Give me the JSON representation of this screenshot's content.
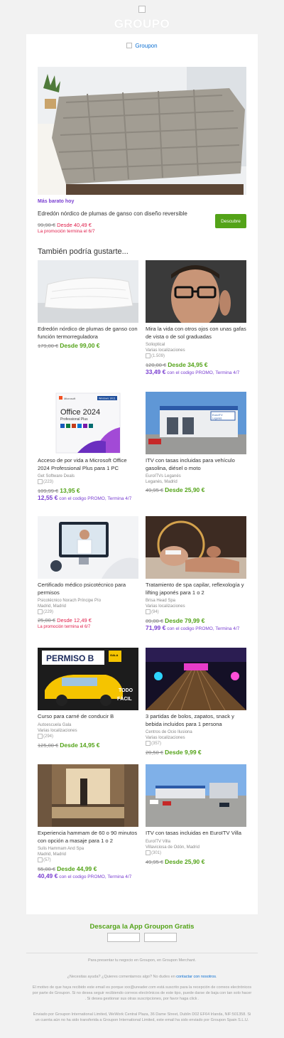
{
  "header": {
    "brand_text": "GROUPO"
  },
  "inner_logo": {
    "alt_text": "Groupon"
  },
  "hero": {
    "tag": "Más barato hoy",
    "title": "Edredón nórdico de plumas de ganso con diseño reversible",
    "old_price": "99,90 €",
    "new_price": "Desde 40,49 €",
    "expiry": "La promoción termina el 6/7",
    "cta": "Descubre"
  },
  "section": {
    "title": "También podría gustarte..."
  },
  "deals": [
    {
      "title": "Edredón nórdico de plumas de ganso con función termorreguladora",
      "merchant": "",
      "location": "",
      "rating": "",
      "old_price": "179,00 €",
      "new_price": "Desde 99,00 €",
      "promo_price": "",
      "promo_text": "",
      "expiry": ""
    },
    {
      "title": "Mira la vida con otros ojos con unas gafas de vista o de sol graduadas",
      "merchant": "Solioptical",
      "location": "Varias localizaciones",
      "rating": "(1.509)",
      "old_price": "120,00 €",
      "new_price": "Desde 34,95 €",
      "promo_price": "33,49 €",
      "promo_text": "con el codigo PROMO, Termina 4/7",
      "expiry": ""
    },
    {
      "title": "Acceso de por vida a Microsoft Office 2024 Professional Plus para 1 PC",
      "merchant": "Get Software Deals",
      "location": "",
      "rating": "(223)",
      "old_price": "109,99 €",
      "new_price": "13,95 €",
      "promo_price": "12,55 €",
      "promo_text": "con el codigo PROMO, Termina 4/7",
      "expiry": ""
    },
    {
      "title": "ITV con tasas incluidas para vehículo gasolina, diésel o moto",
      "merchant": "EuroITVs Leganés",
      "location": "Leganés, Madrid",
      "rating": "",
      "old_price": "49,95 €",
      "new_price": "Desde 25,90 €",
      "promo_price": "",
      "promo_text": "",
      "expiry": ""
    },
    {
      "title": "Certificado médico psicotécnico para permisos",
      "merchant": "Psicotécnico Norach Príncipe Pío",
      "location": "Madrid, Madrid",
      "rating": "(229)",
      "old_price": "25,00 €",
      "new_price": "Desde 12,49 €",
      "promo_price": "",
      "promo_text": "",
      "expiry": "La promoción termina el 6/7"
    },
    {
      "title": "Tratamiento de spa capilar, reflexología y lifting japonés para 1 o 2",
      "merchant": "Brisa Head Spa",
      "location": "Varias localizaciones",
      "rating": "(94)",
      "old_price": "89,00 €",
      "new_price": "Desde 79,99 €",
      "promo_price": "71,99 €",
      "promo_text": "con el codigo PROMO, Termina 4/7",
      "expiry": ""
    },
    {
      "title": "Curso para carné de conducir B",
      "merchant": "Autoescuela Gala",
      "location": "Varias localizaciones",
      "rating": "(294)",
      "old_price": "125,00 €",
      "new_price": "Desde 14,95 €",
      "promo_price": "",
      "promo_text": "",
      "expiry": ""
    },
    {
      "title": "3 partidas de bolos, zapatos, snack y bebida incluidos para 1 persona",
      "merchant": "Centros de Ocio Ilusiona",
      "location": "Varias localizaciones",
      "rating": "(357)",
      "old_price": "20,50 €",
      "new_price": "Desde 9,99 €",
      "promo_price": "",
      "promo_text": "",
      "expiry": ""
    },
    {
      "title": "Experiencia hammam de 60 o 90 minutos con opción a masaje para 1 o 2",
      "merchant": "Sulis Hammam And Spa",
      "location": "Madrid, Madrid",
      "rating": "(57)",
      "old_price": "55,00 €",
      "new_price": "Desde 44,99 €",
      "promo_price": "40,49 €",
      "promo_text": "con el codigo PROMO, Termina 4/7",
      "expiry": ""
    },
    {
      "title": "ITV con tasas incluidas en EuroITV Villa",
      "merchant": "EuroITV Villa",
      "location": "Villaviciosa de Odón, Madrid",
      "rating": "(301)",
      "old_price": "49,95 €",
      "new_price": "Desde 25,90 €",
      "promo_price": "",
      "promo_text": "",
      "expiry": ""
    }
  ],
  "thumb_text": {
    "office_brand": "Microsoft",
    "office_badge": "Windows 10/11",
    "office_title": "Office 2024",
    "office_subtitle": "Professional Plus",
    "itv_sign": "EuroITV",
    "itv_sign_sub": "Leganés",
    "permiso": "PERMISO B",
    "gala": "GALA",
    "todo": "TODO",
    "facil": "FÁCIL"
  },
  "footer": {
    "app_title": "Descarga la App Groupon Gratis",
    "merchant_note": "Para presentar tu negocio en Groupon, en Groupon Merchant.",
    "help_pre": "¿Necesitas ayuda? ¿Quieres comentarnos algo? No dudes en",
    "help_link": "contactar con nosotros",
    "help_post": ".",
    "reason": "El motivo de que haya recibido este email es porque xxx@ureader.com está suscrito para la recepción de correos electrónicos por parte de Groupon. Si no desea seguir recibiendo correos electrónicos de este tipo, puede darse de baja con tan solo hacer . Si desea gestionar sus otras suscripciones, por favor haga click .",
    "sender": "Enviado por Groupon International Limited, WeWork Central Plaza, 36 Dame Street, Dublin D02 EF64 Irlanda, NIF:501358. Si un cuenta aún no ha sido transferida a Groupon International Limited, este email ha sido enviado por Groupon Spain S.L.U."
  },
  "colors": {
    "green": "#53a318",
    "purple": "#7a3fd1",
    "red": "#e0204c",
    "link": "#0b6fd2"
  }
}
